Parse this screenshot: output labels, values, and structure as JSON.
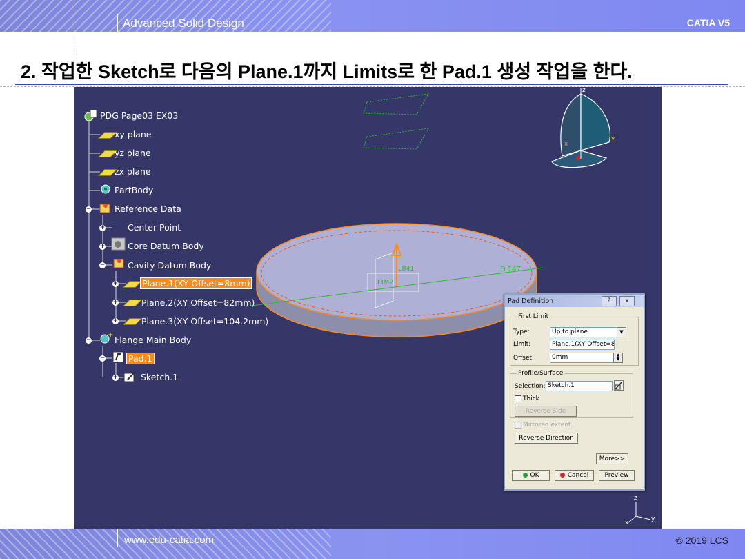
{
  "header": {
    "title": "Advanced Solid Design",
    "brand": "CATIA V5"
  },
  "slide_title": "2. 작업한 Sketch로 다음의 Plane.1까지 Limits로 한 Pad.1 생성 작업을 한다.",
  "footer": {
    "website": "www.edu-catia.com",
    "copyright": "© 2019 LCS"
  },
  "tree": {
    "root": "PDG Page03 EX03",
    "items": [
      {
        "label": "xy plane"
      },
      {
        "label": "yz plane"
      },
      {
        "label": "zx plane"
      },
      {
        "label": "PartBody"
      },
      {
        "label": "Reference Data"
      },
      {
        "label": "Center Point"
      },
      {
        "label": "Core Datum Body"
      },
      {
        "label": "Cavity Datum Body"
      },
      {
        "label": "Plane.1(XY Offset=8mm)"
      },
      {
        "label": "Plane.2(XY Offset=82mm)"
      },
      {
        "label": "Plane.3(XY Offset=104.2mm)"
      },
      {
        "label": "Flange Main Body"
      },
      {
        "label": "Pad.1"
      },
      {
        "label": "Sketch.1"
      }
    ]
  },
  "viewport": {
    "dimension_label": "D 147",
    "dim_marker_1": "LIM1",
    "dim_marker_2": "LIM2",
    "axis_z": "z",
    "axis_y": "y",
    "axis_x": "x",
    "colors": {
      "background": "#353769",
      "highlight": "#ff8a1c",
      "part": "#aeb0d6",
      "sketch": "#2fb82f"
    }
  },
  "dialog": {
    "title": "Pad Definition",
    "help_btn": "?",
    "close_btn": "x",
    "first_limit": {
      "group": "First Limit",
      "type_label": "Type:",
      "type_value": "Up to plane",
      "limit_label": "Limit:",
      "limit_value": "Plane.1(XY Offset=8r",
      "offset_label": "Offset:",
      "offset_value": "0mm"
    },
    "profile": {
      "group": "Profile/Surface",
      "selection_label": "Selection:",
      "selection_value": "Sketch.1",
      "thick_label": "Thick",
      "reverse_side": "Reverse Side"
    },
    "mirrored_extent": "Mirrored extent",
    "reverse_direction": "Reverse Direction",
    "more": "More>>",
    "ok": "OK",
    "cancel": "Cancel",
    "preview": "Preview"
  }
}
